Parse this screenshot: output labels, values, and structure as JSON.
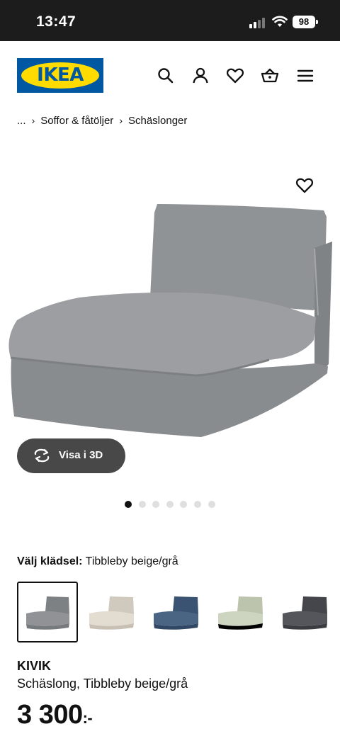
{
  "status_bar": {
    "time": "13:47",
    "battery": "98"
  },
  "header": {
    "logo_text": "IKEA",
    "icons": [
      "search-icon",
      "account-icon",
      "favourites-icon",
      "basket-icon",
      "menu-icon"
    ]
  },
  "breadcrumb": {
    "ellipsis": "...",
    "items": [
      "Soffor & fåtöljer",
      "Schäslonger"
    ]
  },
  "gallery": {
    "view_3d_label": "Visa i 3D",
    "image_count": 7,
    "active_index": 0
  },
  "fabric": {
    "label": "Välj klädsel:",
    "selected": "Tibbleby beige/grå",
    "swatches": [
      {
        "name": "Tibbleby beige/grå",
        "color": "#8e9093",
        "selected": true
      },
      {
        "name": "beige",
        "color": "#d9d3c8",
        "selected": false
      },
      {
        "name": "blue",
        "color": "#3f5878",
        "selected": false
      },
      {
        "name": "light green",
        "color": "#c6cdb8",
        "selected": false
      },
      {
        "name": "dark grey",
        "color": "#4a4b50",
        "selected": false
      }
    ]
  },
  "product": {
    "name": "KIVIK",
    "description": "Schäslong, Tibbleby beige/grå",
    "price": "3 300",
    "price_suffix": ":-"
  },
  "colors": {
    "ikea_blue": "#0058a3",
    "ikea_yellow": "#ffdb00",
    "button_dark": "#484848"
  }
}
